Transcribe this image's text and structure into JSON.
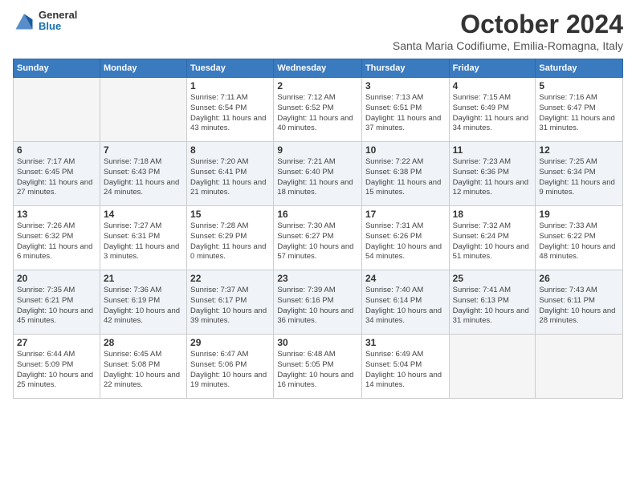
{
  "header": {
    "logo_line1": "General",
    "logo_line2": "Blue",
    "title": "October 2024",
    "subtitle": "Santa Maria Codifiume, Emilia-Romagna, Italy"
  },
  "days_of_week": [
    "Sunday",
    "Monday",
    "Tuesday",
    "Wednesday",
    "Thursday",
    "Friday",
    "Saturday"
  ],
  "weeks": [
    [
      {
        "day": "",
        "sunrise": "",
        "sunset": "",
        "daylight": ""
      },
      {
        "day": "",
        "sunrise": "",
        "sunset": "",
        "daylight": ""
      },
      {
        "day": "1",
        "sunrise": "Sunrise: 7:11 AM",
        "sunset": "Sunset: 6:54 PM",
        "daylight": "Daylight: 11 hours and 43 minutes."
      },
      {
        "day": "2",
        "sunrise": "Sunrise: 7:12 AM",
        "sunset": "Sunset: 6:52 PM",
        "daylight": "Daylight: 11 hours and 40 minutes."
      },
      {
        "day": "3",
        "sunrise": "Sunrise: 7:13 AM",
        "sunset": "Sunset: 6:51 PM",
        "daylight": "Daylight: 11 hours and 37 minutes."
      },
      {
        "day": "4",
        "sunrise": "Sunrise: 7:15 AM",
        "sunset": "Sunset: 6:49 PM",
        "daylight": "Daylight: 11 hours and 34 minutes."
      },
      {
        "day": "5",
        "sunrise": "Sunrise: 7:16 AM",
        "sunset": "Sunset: 6:47 PM",
        "daylight": "Daylight: 11 hours and 31 minutes."
      }
    ],
    [
      {
        "day": "6",
        "sunrise": "Sunrise: 7:17 AM",
        "sunset": "Sunset: 6:45 PM",
        "daylight": "Daylight: 11 hours and 27 minutes."
      },
      {
        "day": "7",
        "sunrise": "Sunrise: 7:18 AM",
        "sunset": "Sunset: 6:43 PM",
        "daylight": "Daylight: 11 hours and 24 minutes."
      },
      {
        "day": "8",
        "sunrise": "Sunrise: 7:20 AM",
        "sunset": "Sunset: 6:41 PM",
        "daylight": "Daylight: 11 hours and 21 minutes."
      },
      {
        "day": "9",
        "sunrise": "Sunrise: 7:21 AM",
        "sunset": "Sunset: 6:40 PM",
        "daylight": "Daylight: 11 hours and 18 minutes."
      },
      {
        "day": "10",
        "sunrise": "Sunrise: 7:22 AM",
        "sunset": "Sunset: 6:38 PM",
        "daylight": "Daylight: 11 hours and 15 minutes."
      },
      {
        "day": "11",
        "sunrise": "Sunrise: 7:23 AM",
        "sunset": "Sunset: 6:36 PM",
        "daylight": "Daylight: 11 hours and 12 minutes."
      },
      {
        "day": "12",
        "sunrise": "Sunrise: 7:25 AM",
        "sunset": "Sunset: 6:34 PM",
        "daylight": "Daylight: 11 hours and 9 minutes."
      }
    ],
    [
      {
        "day": "13",
        "sunrise": "Sunrise: 7:26 AM",
        "sunset": "Sunset: 6:32 PM",
        "daylight": "Daylight: 11 hours and 6 minutes."
      },
      {
        "day": "14",
        "sunrise": "Sunrise: 7:27 AM",
        "sunset": "Sunset: 6:31 PM",
        "daylight": "Daylight: 11 hours and 3 minutes."
      },
      {
        "day": "15",
        "sunrise": "Sunrise: 7:28 AM",
        "sunset": "Sunset: 6:29 PM",
        "daylight": "Daylight: 11 hours and 0 minutes."
      },
      {
        "day": "16",
        "sunrise": "Sunrise: 7:30 AM",
        "sunset": "Sunset: 6:27 PM",
        "daylight": "Daylight: 10 hours and 57 minutes."
      },
      {
        "day": "17",
        "sunrise": "Sunrise: 7:31 AM",
        "sunset": "Sunset: 6:26 PM",
        "daylight": "Daylight: 10 hours and 54 minutes."
      },
      {
        "day": "18",
        "sunrise": "Sunrise: 7:32 AM",
        "sunset": "Sunset: 6:24 PM",
        "daylight": "Daylight: 10 hours and 51 minutes."
      },
      {
        "day": "19",
        "sunrise": "Sunrise: 7:33 AM",
        "sunset": "Sunset: 6:22 PM",
        "daylight": "Daylight: 10 hours and 48 minutes."
      }
    ],
    [
      {
        "day": "20",
        "sunrise": "Sunrise: 7:35 AM",
        "sunset": "Sunset: 6:21 PM",
        "daylight": "Daylight: 10 hours and 45 minutes."
      },
      {
        "day": "21",
        "sunrise": "Sunrise: 7:36 AM",
        "sunset": "Sunset: 6:19 PM",
        "daylight": "Daylight: 10 hours and 42 minutes."
      },
      {
        "day": "22",
        "sunrise": "Sunrise: 7:37 AM",
        "sunset": "Sunset: 6:17 PM",
        "daylight": "Daylight: 10 hours and 39 minutes."
      },
      {
        "day": "23",
        "sunrise": "Sunrise: 7:39 AM",
        "sunset": "Sunset: 6:16 PM",
        "daylight": "Daylight: 10 hours and 36 minutes."
      },
      {
        "day": "24",
        "sunrise": "Sunrise: 7:40 AM",
        "sunset": "Sunset: 6:14 PM",
        "daylight": "Daylight: 10 hours and 34 minutes."
      },
      {
        "day": "25",
        "sunrise": "Sunrise: 7:41 AM",
        "sunset": "Sunset: 6:13 PM",
        "daylight": "Daylight: 10 hours and 31 minutes."
      },
      {
        "day": "26",
        "sunrise": "Sunrise: 7:43 AM",
        "sunset": "Sunset: 6:11 PM",
        "daylight": "Daylight: 10 hours and 28 minutes."
      }
    ],
    [
      {
        "day": "27",
        "sunrise": "Sunrise: 6:44 AM",
        "sunset": "Sunset: 5:09 PM",
        "daylight": "Daylight: 10 hours and 25 minutes."
      },
      {
        "day": "28",
        "sunrise": "Sunrise: 6:45 AM",
        "sunset": "Sunset: 5:08 PM",
        "daylight": "Daylight: 10 hours and 22 minutes."
      },
      {
        "day": "29",
        "sunrise": "Sunrise: 6:47 AM",
        "sunset": "Sunset: 5:06 PM",
        "daylight": "Daylight: 10 hours and 19 minutes."
      },
      {
        "day": "30",
        "sunrise": "Sunrise: 6:48 AM",
        "sunset": "Sunset: 5:05 PM",
        "daylight": "Daylight: 10 hours and 16 minutes."
      },
      {
        "day": "31",
        "sunrise": "Sunrise: 6:49 AM",
        "sunset": "Sunset: 5:04 PM",
        "daylight": "Daylight: 10 hours and 14 minutes."
      },
      {
        "day": "",
        "sunrise": "",
        "sunset": "",
        "daylight": ""
      },
      {
        "day": "",
        "sunrise": "",
        "sunset": "",
        "daylight": ""
      }
    ]
  ]
}
